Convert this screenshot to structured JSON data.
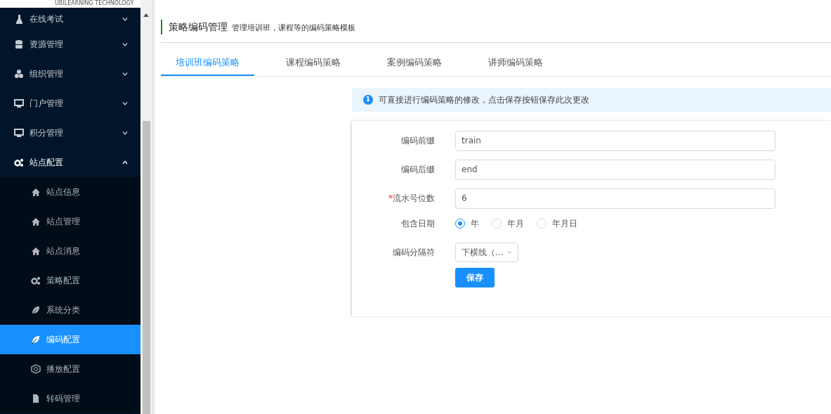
{
  "logo": {
    "text": "UBILEARNING TECHNOLOGY"
  },
  "sidebar": {
    "items": [
      {
        "label": "在线考试",
        "kind": "flask",
        "expanded": false,
        "selected": false
      },
      {
        "label": "资源管理",
        "kind": "database",
        "expanded": false,
        "selected": false
      },
      {
        "label": "组织管理",
        "kind": "cubes",
        "expanded": false,
        "selected": false
      },
      {
        "label": "门户管理",
        "kind": "monitor",
        "expanded": false,
        "selected": false
      },
      {
        "label": "积分管理",
        "kind": "monitor",
        "expanded": false,
        "selected": false
      },
      {
        "label": "站点配置",
        "kind": "gears",
        "expanded": true,
        "selected": false,
        "children": [
          {
            "label": "站点信息",
            "kind": "home",
            "selected": false
          },
          {
            "label": "站点管理",
            "kind": "home",
            "selected": false
          },
          {
            "label": "站点消息",
            "kind": "home",
            "selected": false
          },
          {
            "label": "策略配置",
            "kind": "gears",
            "selected": false
          },
          {
            "label": "系统分类",
            "kind": "leaf",
            "selected": false
          },
          {
            "label": "编码配置",
            "kind": "leaf",
            "selected": true
          },
          {
            "label": "播放配置",
            "kind": "hexagon",
            "selected": false
          },
          {
            "label": "转码管理",
            "kind": "file",
            "selected": false
          }
        ]
      }
    ]
  },
  "page": {
    "title": "策略编码管理",
    "subtitle": "管理培训班，课程等的编码策略模板"
  },
  "tabs": [
    {
      "label": "培训班编码策略",
      "selected": true
    },
    {
      "label": "课程编码策略",
      "selected": false
    },
    {
      "label": "案例编码策略",
      "selected": false
    },
    {
      "label": "讲师编码策略",
      "selected": false
    }
  ],
  "notice": {
    "badge": "1",
    "text": "可直接进行编码策略的修改，点击保存按钮保存此次更改"
  },
  "form": {
    "fields": [
      {
        "kind": "text",
        "label": "编码前缀",
        "value": "train"
      },
      {
        "kind": "text",
        "label": "编码后缀",
        "value": "end"
      },
      {
        "kind": "text",
        "label": "流水号位数",
        "required_mark": "*",
        "value": "6"
      },
      {
        "kind": "radio",
        "label": "包含日期",
        "options": [
          {
            "label": "年",
            "selected": true
          },
          {
            "label": "年月",
            "selected": false
          },
          {
            "label": "年月日",
            "selected": false
          }
        ]
      },
      {
        "kind": "select",
        "label": "编码分隔符",
        "value": "下横线（..."
      }
    ],
    "submit": "保存"
  }
}
